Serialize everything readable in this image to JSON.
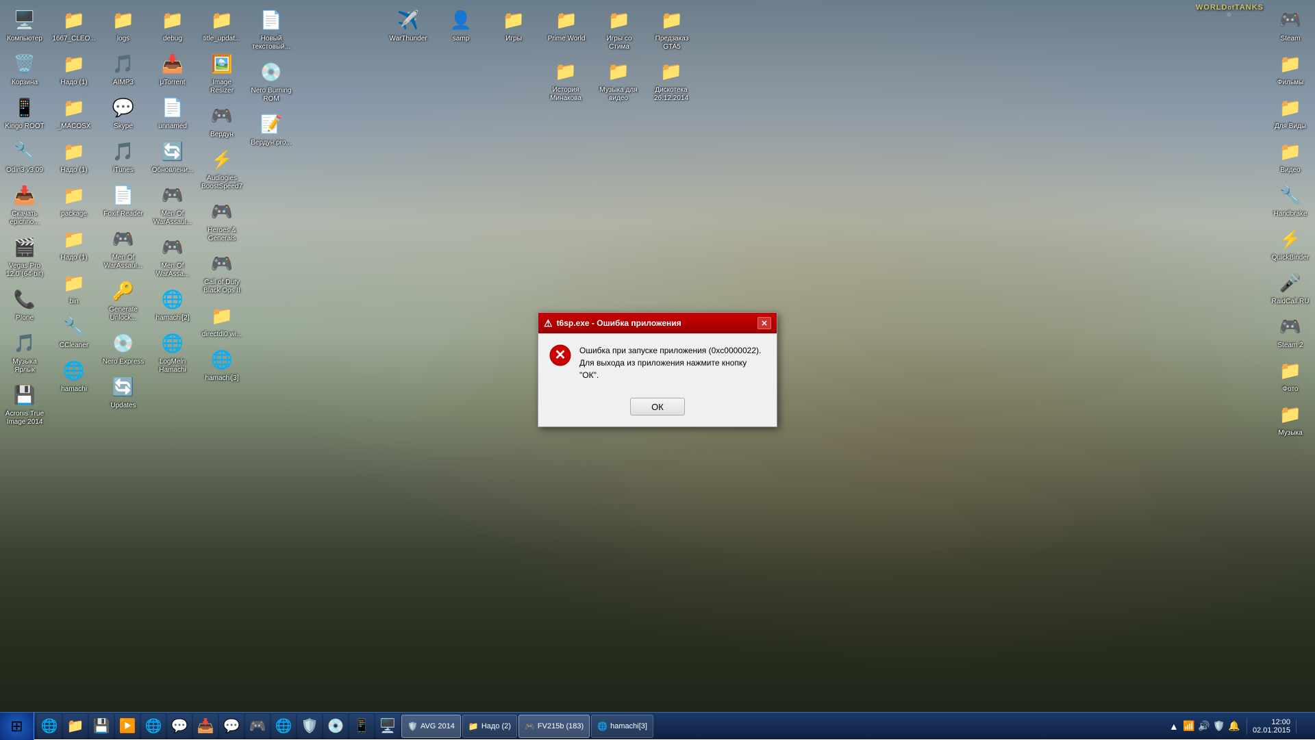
{
  "desktop": {
    "background": "World of Tanks",
    "wallpaper_description": "Tank battle scene"
  },
  "wot_logo": {
    "line1": "WORLD of TANK",
    "line2": "S"
  },
  "dialog": {
    "title": "t6sp.exe - Ошибка приложения",
    "message": "Ошибка при запуске приложения (0xc0000022). Для выхода из приложения нажмите кнопку \"ОК\".",
    "ok_button": "ОК",
    "close_button": "✕"
  },
  "left_col1": [
    {
      "label": "Компьютер",
      "icon": "🖥️"
    },
    {
      "label": "Корзина",
      "icon": "🗑️"
    },
    {
      "label": "Kingo ROOT",
      "icon": "📱"
    },
    {
      "label": "Odin3 v3.09",
      "icon": "🔧"
    },
    {
      "label": "Скачать epichno...",
      "icon": "📥"
    },
    {
      "label": "Vegas Pro 12.0 (64-bit)",
      "icon": "🎬"
    },
    {
      "label": "PIone",
      "icon": "📞"
    },
    {
      "label": "Музыка Ярлык",
      "icon": "🎵"
    },
    {
      "label": "Acronis True Image 2014",
      "icon": "💾"
    }
  ],
  "left_col2": [
    {
      "label": "1667_CLEO...",
      "icon": "📁"
    },
    {
      "label": "Надо (1)",
      "icon": "📁"
    },
    {
      "label": "_MACOSX",
      "icon": "📁"
    },
    {
      "label": "Надо (1)",
      "icon": "📁"
    },
    {
      "label": "package",
      "icon": "📁"
    },
    {
      "label": "Надо (1)",
      "icon": "📁"
    },
    {
      "label": "bin",
      "icon": "📁"
    },
    {
      "label": "CCleaner",
      "icon": "🔧"
    },
    {
      "label": "hamachi",
      "icon": "🌐"
    }
  ],
  "left_col3": [
    {
      "label": "logs",
      "icon": "📁"
    },
    {
      "label": "AIMP3",
      "icon": "🎵"
    },
    {
      "label": "Skype",
      "icon": "💬"
    },
    {
      "label": "iTunes",
      "icon": "🎵"
    },
    {
      "label": "Foxit Reader",
      "icon": "📄"
    },
    {
      "label": "Men Of WarAssaul...",
      "icon": "🎮"
    },
    {
      "label": "Generate Unlock...",
      "icon": "🔑"
    },
    {
      "label": "Nero Express",
      "icon": "💿"
    },
    {
      "label": "Updates",
      "icon": "🔄"
    }
  ],
  "left_col4": [
    {
      "label": "debug",
      "icon": "📁"
    },
    {
      "label": "μTorrent",
      "icon": "📥"
    },
    {
      "label": "unnamed",
      "icon": "📁"
    },
    {
      "label": "Обновлени...",
      "icon": "🔄"
    },
    {
      "label": "Men Of WarAssaul...",
      "icon": "🎮"
    },
    {
      "label": "Men Of WarAssa...",
      "icon": "🎮"
    },
    {
      "label": "hamachi[2]",
      "icon": "🌐"
    },
    {
      "label": "LogMeln Hamachi",
      "icon": "🌐"
    }
  ],
  "left_col5": [
    {
      "label": "title_updat...",
      "icon": "📁"
    },
    {
      "label": "Image Resizer",
      "icon": "🖼️"
    },
    {
      "label": "Вердун",
      "icon": "🎮"
    },
    {
      "label": "Audlogies BoostSpeed7",
      "icon": "⚡"
    },
    {
      "label": "Heroes & Generals",
      "icon": "🎮"
    },
    {
      "label": "Call of Duty Black Ops II",
      "icon": "🎮"
    },
    {
      "label": "directdl0 wi...",
      "icon": "📁"
    },
    {
      "label": "hamachi[3]",
      "icon": "🌐"
    }
  ],
  "left_col6": [
    {
      "label": "Новый текстовый...",
      "icon": "📄"
    },
    {
      "label": "Nero Burning ROM",
      "icon": "💿"
    },
    {
      "label": "Вердун.pro...",
      "icon": "📝"
    }
  ],
  "top_center": [
    {
      "label": "WarThunder",
      "icon": "✈️"
    },
    {
      "label": "samp",
      "icon": "👤"
    },
    {
      "label": "Игры",
      "icon": "📁"
    },
    {
      "label": "Prime World",
      "icon": "📁"
    },
    {
      "label": "Игры со Стима",
      "icon": "📁"
    },
    {
      "label": "Предзаказ GTA5",
      "icon": "📁"
    }
  ],
  "top_right_folders": [
    {
      "label": "История Минакова",
      "icon": "📁"
    },
    {
      "label": "Музыка для видео",
      "icon": "📁"
    },
    {
      "label": "Дискотека 26.12.2014",
      "icon": "📁"
    }
  ],
  "right_col": [
    {
      "label": "Steam",
      "icon": "🎮"
    },
    {
      "label": "Фильмы",
      "icon": "📁"
    },
    {
      "label": "Для Виды",
      "icon": "📁"
    },
    {
      "label": "Видео",
      "icon": "📁"
    },
    {
      "label": "Handbrake",
      "icon": "🔧"
    },
    {
      "label": "QuickBinder",
      "icon": "⚡"
    },
    {
      "label": "RaidCall.RU",
      "icon": "🎤"
    },
    {
      "label": "Steam 2",
      "icon": "🎮"
    },
    {
      "label": "Фото",
      "icon": "🖼️"
    },
    {
      "label": "Музыка",
      "icon": "🎵"
    }
  ],
  "taskbar": {
    "start_icon": "⊞",
    "apps": [
      {
        "label": "AVG 2014",
        "icon": "🛡️"
      },
      {
        "label": "Надо (2)",
        "icon": "📁"
      },
      {
        "label": "FV215b (183)",
        "icon": "🎮"
      },
      {
        "label": "hamachi[3]",
        "icon": "🌐"
      }
    ],
    "quick_launch": [
      {
        "name": "ie-icon",
        "icon": "🌐"
      },
      {
        "name": "file-explorer-icon",
        "icon": "📁"
      },
      {
        "name": "acronis-icon",
        "icon": "💾"
      },
      {
        "name": "media-icon",
        "icon": "▶️"
      },
      {
        "name": "chrome-icon",
        "icon": "🌐"
      },
      {
        "name": "skype-icon",
        "icon": "💬"
      },
      {
        "name": "utorrent-icon",
        "icon": "📥"
      },
      {
        "name": "skype2-icon",
        "icon": "💬"
      },
      {
        "name": "steam-icon",
        "icon": "🎮"
      },
      {
        "name": "chrome2-icon",
        "icon": "🌐"
      },
      {
        "name": "spyware-icon",
        "icon": "🛡️"
      },
      {
        "name": "daemon-icon",
        "icon": "💿"
      },
      {
        "name": "app1-icon",
        "icon": "📱"
      },
      {
        "name": "app2-icon",
        "icon": "🖥️"
      }
    ],
    "tray": {
      "time": "12:00",
      "date": "02.01.2015"
    }
  }
}
